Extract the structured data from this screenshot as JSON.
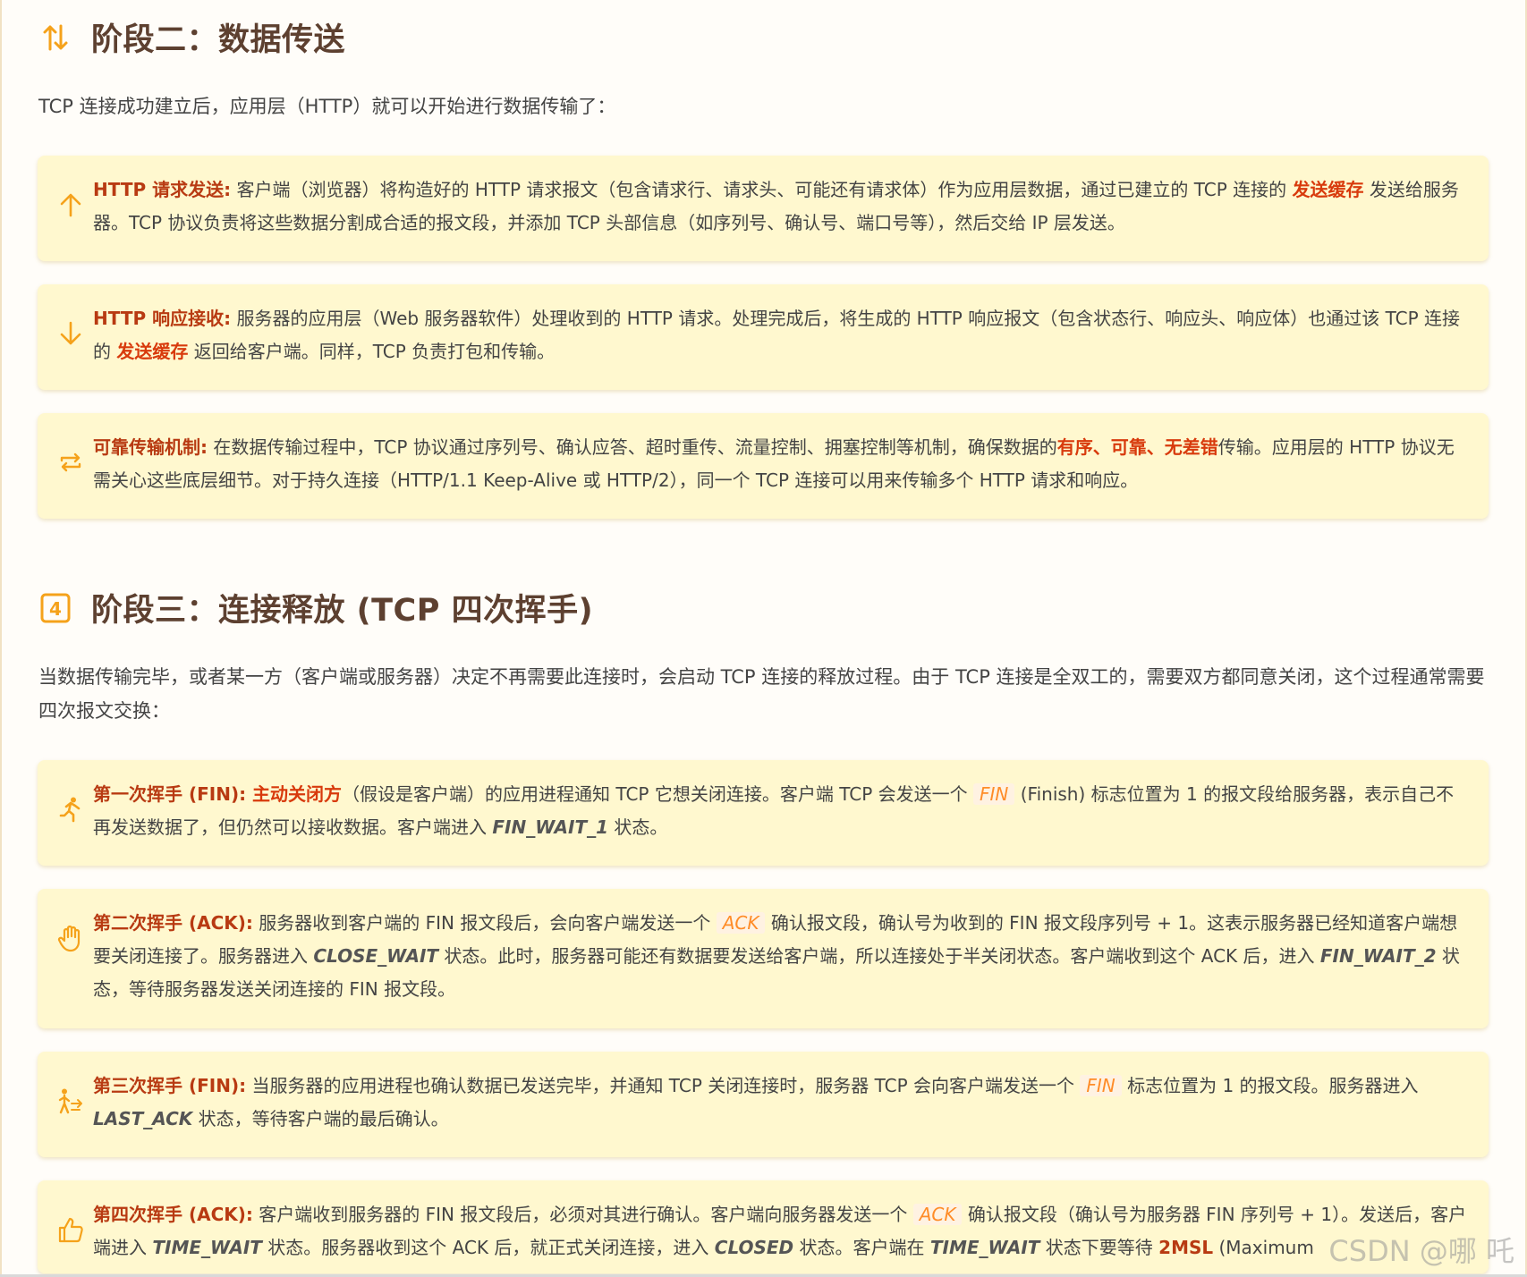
{
  "section2": {
    "title": "阶段二：数据传送",
    "intro": "TCP 连接成功建立后，应用层（HTTP）就可以开始进行数据传输了："
  },
  "section2_cards": [
    {
      "icon": "arrow-up-icon",
      "label": "HTTP 请求发送:",
      "t1": " 客户端（浏览器）将构造好的 HTTP 请求报文（包含请求行、请求头、可能还有请求体）作为应用层数据，通过已建立的 TCP 连接的 ",
      "hl1": "发送缓存",
      "t2": " 发送给服务器。TCP 协议负责将这些数据分割成合适的报文段，并添加 TCP 头部信息（如序列号、确认号、端口号等），然后交给 IP 层发送。"
    },
    {
      "icon": "arrow-down-icon",
      "label": "HTTP 响应接收:",
      "t1": " 服务器的应用层（Web 服务器软件）处理收到的 HTTP 请求。处理完成后，将生成的 HTTP 响应报文（包含状态行、响应头、响应体）也通过该 TCP 连接的 ",
      "hl1": "发送缓存",
      "t2": " 返回给客户端。同样，TCP 负责打包和传输。"
    },
    {
      "icon": "repeat-icon",
      "label": "可靠传输机制:",
      "t1": " 在数据传输过程中，TCP 协议通过序列号、确认应答、超时重传、流量控制、拥塞控制等机制，确保数据的",
      "hl1": "有序、可靠、无差错",
      "t2": "传输。应用层的 HTTP 协议无需关心这些底层细节。对于持久连接（HTTP/1.1 Keep-Alive 或 HTTP/2），同一个 TCP 连接可以用来传输多个 HTTP 请求和响应。"
    }
  ],
  "section3": {
    "title": "阶段三：连接释放 (TCP 四次挥手)",
    "badge": "4",
    "intro": "当数据传输完毕，或者某一方（客户端或服务器）决定不再需要此连接时，会启动 TCP 连接的释放过程。由于 TCP 连接是全双工的，需要双方都同意关闭，这个过程通常需要四次报文交换："
  },
  "handshake": [
    {
      "icon": "person-running-icon",
      "label": "第一次挥手 (FIN):",
      "lbl2": " 主动关闭方",
      "t1": "（假设是客户端）的应用进程通知 TCP 它想关闭连接。客户端 TCP 会发送一个 ",
      "code": "FIN",
      "t2": " (Finish) 标志位置为 1 的报文段给服务器，表示自己不再发送数据了，但仍然可以接收数据。客户端进入 ",
      "state": "FIN_WAIT_1",
      "t3": " 状态。"
    },
    {
      "icon": "hand-icon",
      "label": "第二次挥手 (ACK):",
      "t1": " 服务器收到客户端的 FIN 报文段后，会向客户端发送一个 ",
      "code": "ACK",
      "t2": " 确认报文段，确认号为收到的 FIN 报文段序列号 + 1。这表示服务器已经知道客户端想要关闭连接了。服务器进入 ",
      "state": "CLOSE_WAIT",
      "t3": " 状态。此时，服务器可能还有数据要发送给客户端，所以连接处于半关闭状态。客户端收到这个 ACK 后，进入 ",
      "state2": "FIN_WAIT_2",
      "t4": " 状态，等待服务器发送关闭连接的 FIN 报文段。"
    },
    {
      "icon": "person-walking-icon",
      "label": "第三次挥手 (FIN):",
      "t1": " 当服务器的应用进程也确认数据已发送完毕，并通知 TCP 关闭连接时，服务器 TCP 会向客户端发送一个 ",
      "code": "FIN",
      "t2": " 标志位置为 1 的报文段。服务器进入 ",
      "state": "LAST_ACK",
      "t3": " 状态，等待客户端的最后确认。"
    },
    {
      "icon": "thumbs-up-icon",
      "label": "第四次挥手 (ACK):",
      "t1": " 客户端收到服务器的 FIN 报文段后，必须对其进行确认。客户端向服务器发送一个 ",
      "code": "ACK",
      "t2": " 确认报文段（确认号为服务器 FIN 序列号 + 1）。发送后，客户端进入 ",
      "state": "TIME_WAIT",
      "t3": " 状态。服务器收到这个 ACK 后，就正式关闭连接，进入 ",
      "state2": "CLOSED",
      "t4": " 状态。客户端在 ",
      "state3": "TIME_WAIT",
      "t5": " 状态下要等待 ",
      "bold": "2MSL",
      "t6": " (Maximum"
    }
  ],
  "watermark": "CSDN @哪 吒",
  "colors": {
    "accent": "#f5a21b",
    "label": "#b83a12",
    "highlight": "#d83a0c",
    "card_bg": "#fff8cf",
    "code": "#ff8c28",
    "heading": "#5d4030"
  }
}
